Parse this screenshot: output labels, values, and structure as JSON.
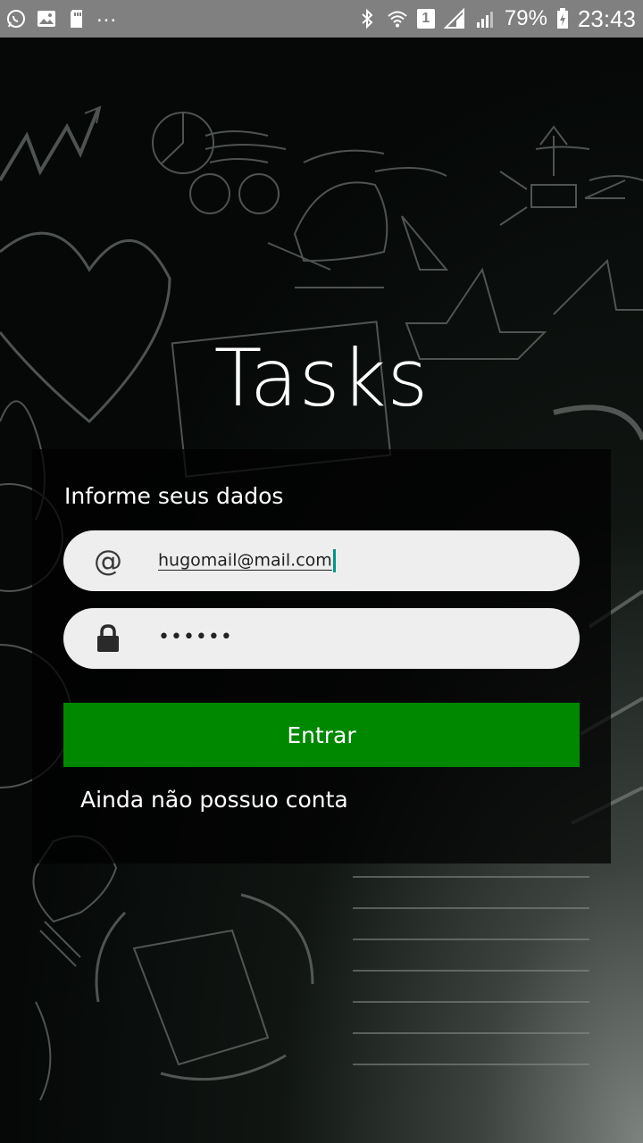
{
  "status_bar": {
    "left_icons": [
      "whatsapp-icon",
      "image-icon",
      "sd-card-icon"
    ],
    "more": "...",
    "right_icons": [
      "bluetooth-icon",
      "wifi-icon",
      "sim-icon",
      "signal-icon"
    ],
    "sim_slot": "1",
    "battery": "79%",
    "time": "23:43"
  },
  "app": {
    "title": "Tasks"
  },
  "login": {
    "prompt": "Informe seus dados",
    "email_icon": "@",
    "email_value": "hugomail@mail.com",
    "password_value": "••••••",
    "submit_label": "Entrar",
    "signup_label": "Ainda não possuo conta"
  },
  "colors": {
    "status_bar": "#808080",
    "field_bg": "#eeeeee",
    "button": "#008800",
    "caret": "#009688"
  }
}
